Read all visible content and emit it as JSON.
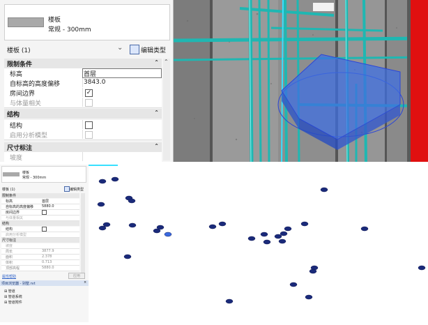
{
  "properties": {
    "type_name": "楼板",
    "type_sub": "常规 - 300mm",
    "instance_count": "楼板 (1)",
    "edit_type": "编辑类型",
    "sections": {
      "constraints": "限制条件",
      "structure": "结构",
      "dimensions": "尺寸标注"
    },
    "rows": {
      "level_label": "标高",
      "level_value": "首层",
      "offset_label": "自标高的高度偏移",
      "offset_value": "3843.0",
      "room_bounding_label": "房间边界",
      "mass_label": "与体量相关",
      "structural_label": "结构",
      "analytical_label": "启用分析模型",
      "slope_label": "坡度"
    },
    "checkmark": "✓"
  },
  "mini_panel": {
    "type_name": "楼板",
    "type_sub": "常规 - 300mm",
    "instance_count": "楼板 (1)",
    "edit_type": "编辑类型",
    "sec_constraints": "限制条件",
    "level_label": "标高",
    "level_value": "首层",
    "offset_label": "自标高的高度偏移",
    "offset_value": "5880.0",
    "room_label": "房间边界",
    "mass_label": "与体量相关",
    "sec_structure": "结构",
    "struct_label": "结构",
    "analytic_label": "启用分析模型",
    "sec_dims": "尺寸标注",
    "slope_label": "坡度",
    "perimeter_label": "周长",
    "perimeter_value": "3877.9",
    "area_label": "面积",
    "area_value": "2.378",
    "volume_label": "体积",
    "volume_value": "0.713",
    "top_elev_label": "顶部高程",
    "top_elev_value": "5880.0",
    "help_link": "属性帮助",
    "apply_button": "应用",
    "browser_title": "项目浏览器 - 别墅.rvt",
    "browser_items": [
      "管道",
      "管道系统",
      "管道附件"
    ]
  },
  "colors": {
    "accent_cyan": "#18b5b5",
    "selection_blue": "#3f6fe0",
    "red_edge": "#e01010",
    "marker_navy": "#1a2a7a"
  }
}
